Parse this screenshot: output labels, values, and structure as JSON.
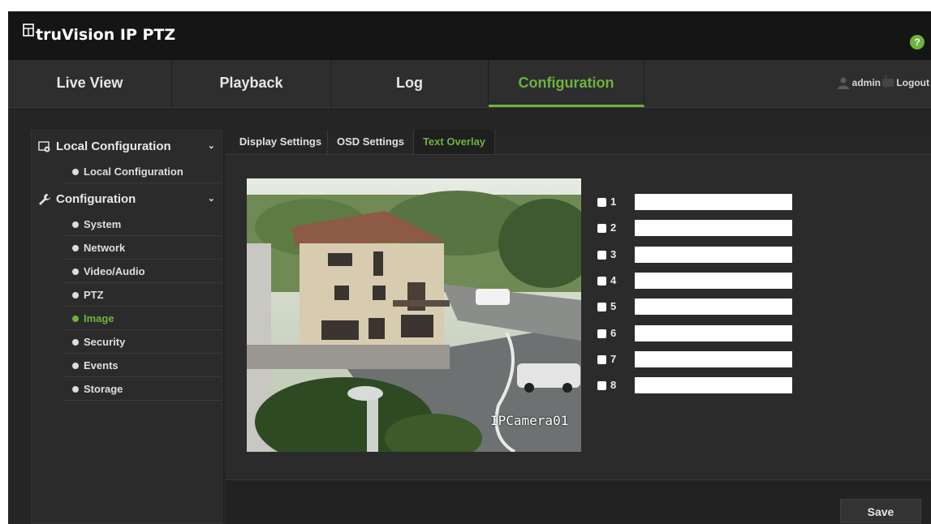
{
  "app": {
    "brand": "truVision IP PTZ",
    "help_symbol": "?"
  },
  "nav": {
    "tabs": [
      {
        "label": "Live View",
        "active": false
      },
      {
        "label": "Playback",
        "active": false
      },
      {
        "label": "Log",
        "active": false
      },
      {
        "label": "Configuration",
        "active": true
      }
    ],
    "user": "admin",
    "logout": "Logout"
  },
  "sidebar": {
    "groups": [
      {
        "label": "Local Configuration",
        "icon": "local-config-icon",
        "items": [
          "Local Configuration"
        ]
      },
      {
        "label": "Configuration",
        "icon": "wrench-icon",
        "items": [
          "System",
          "Network",
          "Video/Audio",
          "PTZ",
          "Image",
          "Security",
          "Events",
          "Storage"
        ]
      }
    ],
    "active_item": "Image"
  },
  "subtabs": [
    {
      "label": "Display Settings",
      "active": false
    },
    {
      "label": "OSD Settings",
      "active": false
    },
    {
      "label": "Text Overlay",
      "active": true
    }
  ],
  "preview": {
    "camera_name": "IPCamera01"
  },
  "overlays": [
    {
      "num": "1",
      "checked": false,
      "value": ""
    },
    {
      "num": "2",
      "checked": false,
      "value": ""
    },
    {
      "num": "3",
      "checked": false,
      "value": ""
    },
    {
      "num": "4",
      "checked": false,
      "value": ""
    },
    {
      "num": "5",
      "checked": false,
      "value": ""
    },
    {
      "num": "6",
      "checked": false,
      "value": ""
    },
    {
      "num": "7",
      "checked": false,
      "value": ""
    },
    {
      "num": "8",
      "checked": false,
      "value": ""
    }
  ],
  "save_label": "Save",
  "colors": {
    "accent": "#6db33f",
    "background": "#252525",
    "header": "#151515"
  }
}
